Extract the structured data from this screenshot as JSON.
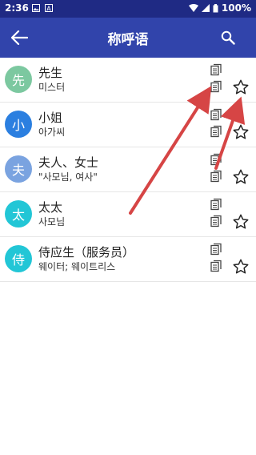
{
  "status": {
    "time": "2:36",
    "battery": "100%"
  },
  "appbar": {
    "title": "称呼语"
  },
  "icons": {
    "back": "arrow-left-icon",
    "search": "search-icon",
    "copy": "copy-icon",
    "star": "star-outline-icon"
  },
  "colors": {
    "statusbar": "#1f2a84",
    "appbar": "#3144ab",
    "arrow": "#d64545"
  },
  "items": [
    {
      "avatar": "先",
      "color": "#7cc8a0",
      "term": "先生",
      "translation": "미스터"
    },
    {
      "avatar": "小",
      "color": "#2b7fe0",
      "term": "小姐",
      "translation": "아가씨"
    },
    {
      "avatar": "夫",
      "color": "#7aa3e0",
      "term": "夫人、女士",
      "translation": "\"사모님, 여사\""
    },
    {
      "avatar": "太",
      "color": "#22c6d6",
      "term": "太太",
      "translation": "사모님"
    },
    {
      "avatar": "侍",
      "color": "#22c6d6",
      "term": "侍应生（服务员）",
      "translation": "웨이터; 웨이트리스"
    }
  ]
}
